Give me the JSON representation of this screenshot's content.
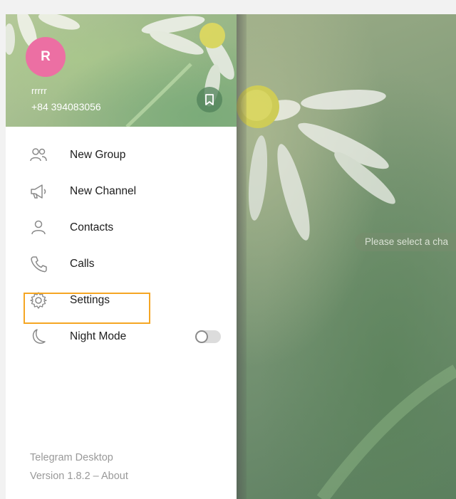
{
  "profile": {
    "avatar_initial": "R",
    "name": "rrrrr",
    "phone": "+84 394083056"
  },
  "menu": {
    "items": [
      {
        "label": "New Group",
        "icon": "users-icon"
      },
      {
        "label": "New Channel",
        "icon": "megaphone-icon"
      },
      {
        "label": "Contacts",
        "icon": "user-icon"
      },
      {
        "label": "Calls",
        "icon": "phone-icon"
      },
      {
        "label": "Settings",
        "icon": "gear-icon"
      },
      {
        "label": "Night Mode",
        "icon": "moon-icon"
      }
    ],
    "night_mode_on": false
  },
  "footer": {
    "app_name": "Telegram Desktop",
    "version": "Version 1.8.2 – About"
  },
  "chat": {
    "placeholder": "Please select a cha"
  },
  "colors": {
    "avatar": "#ec6fa3",
    "highlight": "#f5a623"
  }
}
